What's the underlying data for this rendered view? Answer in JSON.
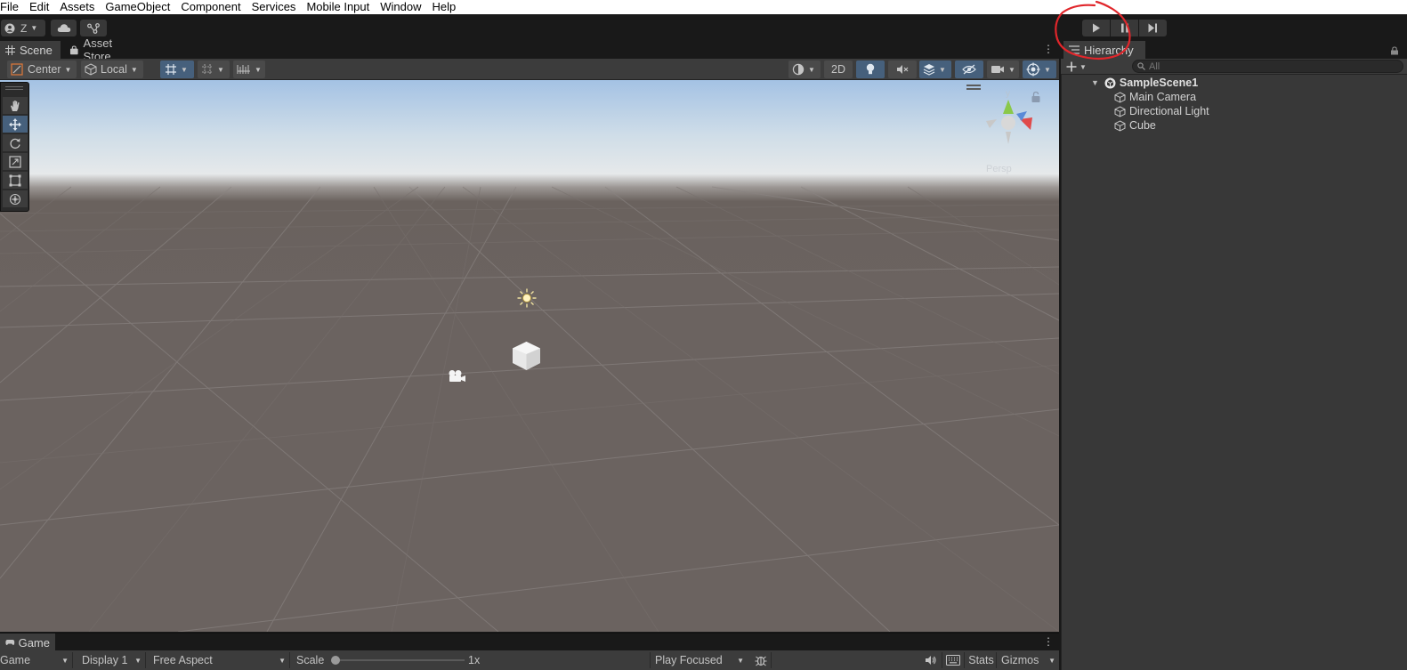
{
  "menu": [
    "File",
    "Edit",
    "Assets",
    "GameObject",
    "Component",
    "Services",
    "Mobile Input",
    "Window",
    "Help"
  ],
  "toolbar": {
    "account_label": "Z",
    "account_icon": "account-icon",
    "cloud_icon": "cloud-icon",
    "collab_icon": "collab-icon",
    "play_icon": "play-icon",
    "pause_icon": "pause-icon",
    "step_icon": "step-icon"
  },
  "scene": {
    "tabs": [
      "Scene",
      "Asset Store"
    ],
    "pivot_label": "Center",
    "space_label": "Local",
    "mode_2d_label": "2D",
    "gizmo_axis_label": "y",
    "persp_label": "Persp"
  },
  "tools": [
    "view-hand",
    "move",
    "rotate",
    "scale",
    "rect",
    "transform"
  ],
  "hierarchy": {
    "tab_label": "Hierarchy",
    "search_placeholder": "All",
    "scene_name": "SampleScene1",
    "items": [
      "Main Camera",
      "Directional Light",
      "Cube"
    ]
  },
  "game": {
    "tab_label": "Game",
    "view_select": "Game",
    "display_select": "Display 1",
    "aspect_select": "Free Aspect",
    "scale_label": "Scale",
    "scale_value": "1x",
    "play_focus": "Play Focused",
    "stats_label": "Stats",
    "gizmos_label": "Gizmos"
  },
  "colors": {
    "annotation": "#e0262b",
    "accent": "#46607c",
    "panel": "#383838"
  }
}
